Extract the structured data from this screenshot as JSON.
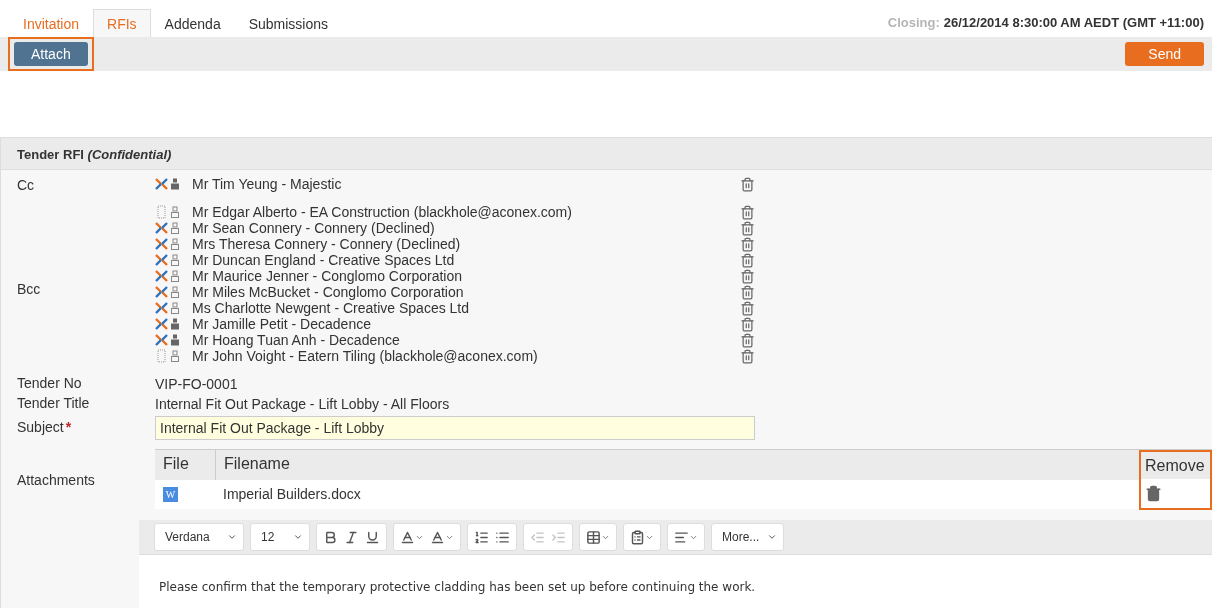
{
  "tabs": [
    {
      "label": "Invitation",
      "selected": false,
      "visited": true
    },
    {
      "label": "RFIs",
      "selected": true,
      "visited": false
    },
    {
      "label": "Addenda",
      "selected": false,
      "visited": false
    },
    {
      "label": "Submissions",
      "selected": false,
      "visited": false
    }
  ],
  "closing": {
    "label": "Closing:",
    "value": "26/12/2014 8:30:00 AM AEDT (GMT +11:00)"
  },
  "action_bar": {
    "attach": {
      "label": "Attach",
      "highlighted": true
    },
    "send": {
      "label": "Send"
    }
  },
  "panel": {
    "title": "Tender RFI",
    "title_note": "(Confidential)",
    "cc": {
      "label": "Cc",
      "recipients": [
        {
          "name": "Mr Tim Yeung - Majestic",
          "kind": "member",
          "confirmed": true
        }
      ]
    },
    "bcc": {
      "label": "Bcc",
      "recipients": [
        {
          "name": "Mr Edgar Alberto - EA Construction (blackhole@aconex.com)",
          "kind": "guest",
          "confirmed": false
        },
        {
          "name": "Mr Sean Connery - Connery (Declined)",
          "kind": "member",
          "confirmed": false
        },
        {
          "name": "Mrs Theresa Connery - Connery (Declined)",
          "kind": "member",
          "confirmed": false
        },
        {
          "name": "Mr Duncan England - Creative Spaces Ltd",
          "kind": "member",
          "confirmed": false
        },
        {
          "name": "Mr Maurice Jenner - Conglomo Corporation",
          "kind": "member",
          "confirmed": false
        },
        {
          "name": "Mr Miles McBucket - Conglomo Corporation",
          "kind": "member",
          "confirmed": false
        },
        {
          "name": "Ms Charlotte Newgent - Creative Spaces Ltd",
          "kind": "member",
          "confirmed": false
        },
        {
          "name": "Mr Jamille Petit - Decadence",
          "kind": "member",
          "confirmed": true
        },
        {
          "name": "Mr Hoang Tuan Anh - Decadence",
          "kind": "member",
          "confirmed": true
        },
        {
          "name": "Mr John Voight - Eatern Tiling (blackhole@aconex.com)",
          "kind": "guest",
          "confirmed": false
        }
      ]
    },
    "tender_no": {
      "label": "Tender No",
      "value": "VIP-FO-0001"
    },
    "tender_title": {
      "label": "Tender Title",
      "value": "Internal Fit Out Package - Lift Lobby - All Floors"
    },
    "subject": {
      "label": "Subject",
      "required_mark": "*",
      "value": "Internal Fit Out Package - Lift Lobby"
    },
    "attachments": {
      "label": "Attachments",
      "columns": [
        "File",
        "Filename",
        "Remove"
      ],
      "remove_highlighted": true,
      "rows": [
        {
          "filename": "Imperial Builders.docx",
          "file_letter": "W"
        }
      ]
    },
    "editor": {
      "toolbar": [
        {
          "kind": "select",
          "label": "Verdana"
        },
        {
          "kind": "select",
          "label": "12"
        },
        {
          "kind": "group",
          "buttons": [
            {
              "kind": "bold"
            },
            {
              "kind": "italic"
            },
            {
              "kind": "underline"
            }
          ],
          "disabled": false
        },
        {
          "kind": "group",
          "buttons": [
            {
              "kind": "text-color"
            },
            {
              "kind": "highlight-color"
            }
          ],
          "disabled": false
        },
        {
          "kind": "group",
          "buttons": [
            {
              "kind": "numbered-list"
            },
            {
              "kind": "bullet-list"
            }
          ],
          "disabled": false
        },
        {
          "kind": "group",
          "buttons": [
            {
              "kind": "outdent"
            },
            {
              "kind": "indent"
            }
          ],
          "disabled": true
        },
        {
          "kind": "group",
          "buttons": [
            {
              "kind": "table"
            }
          ],
          "disabled": false
        },
        {
          "kind": "group",
          "buttons": [
            {
              "kind": "paste"
            }
          ],
          "disabled": false
        },
        {
          "kind": "group",
          "buttons": [
            {
              "kind": "align"
            }
          ],
          "disabled": false
        },
        {
          "kind": "select",
          "label": "More..."
        }
      ],
      "body": "Please confirm that the temporary protective cladding has been set up before continuing the work."
    }
  }
}
